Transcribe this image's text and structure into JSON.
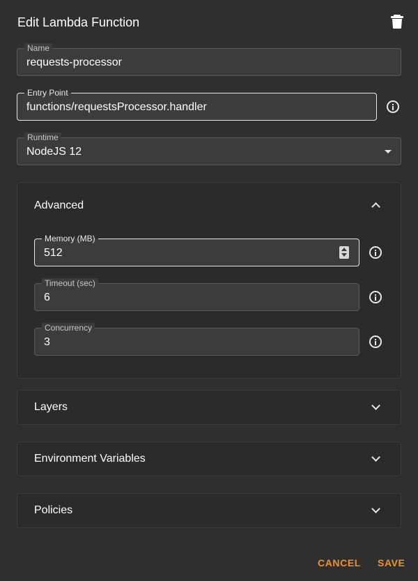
{
  "dialog": {
    "title": "Edit Lambda Function",
    "delete_icon": "trash-icon"
  },
  "fields": {
    "name": {
      "label": "Name",
      "value": "requests-processor"
    },
    "entry_point": {
      "label": "Entry Point",
      "value": "functions/requestsProcessor.handler"
    },
    "runtime": {
      "label": "Runtime",
      "value": "NodeJS 12"
    }
  },
  "advanced": {
    "title": "Advanced",
    "expanded": true,
    "memory": {
      "label": "Memory (MB)",
      "value": "512"
    },
    "timeout": {
      "label": "Timeout (sec)",
      "value": "6"
    },
    "concurrency": {
      "label": "Concurrency",
      "value": "3"
    }
  },
  "sections": {
    "layers": "Layers",
    "environment": "Environment Variables",
    "policies": "Policies"
  },
  "actions": {
    "cancel": "CANCEL",
    "save": "SAVE"
  },
  "colors": {
    "background": "#2f2f2f",
    "field_bg": "#3c3c3c",
    "accent": "#f0922a"
  }
}
